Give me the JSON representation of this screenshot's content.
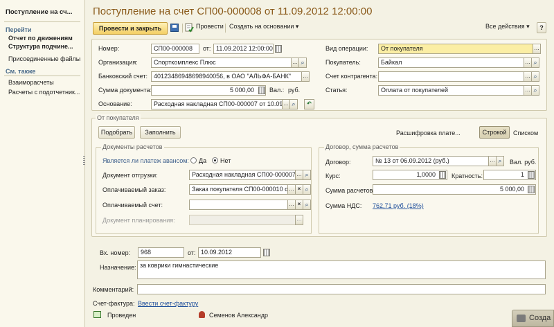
{
  "sidebar": {
    "header": "Поступление на сч...",
    "goto_title": "Перейти",
    "items": [
      {
        "label": "Отчет по движениям"
      },
      {
        "label": "Структура подчине..."
      },
      {
        "label": "Присоединенные файлы"
      }
    ],
    "see_also_title": "См. также",
    "see_also_items": [
      {
        "label": "Взаиморасчеты"
      },
      {
        "label": "Расчеты с подотчетник..."
      }
    ]
  },
  "title": "Поступление на счет СП00-000008 от 11.09.2012 12:00:00",
  "toolbar": {
    "post_close": "Провести и закрыть",
    "post": "Провести",
    "create_based": "Создать на основании",
    "all_actions": "Все действия",
    "help": "?"
  },
  "header": {
    "number_label": "Номер:",
    "number_value": "СП00-000008",
    "from_label": "от:",
    "date_value": "11.09.2012 12:00:00",
    "org_label": "Организация:",
    "org_value": "Спорткомплекс Плюс",
    "bank_label": "Банковский счет:",
    "bank_value": "40123486948698940056, в ОАО \"АЛЬФА-БАНК\"",
    "sum_label": "Сумма документа:",
    "sum_value": "5 000,00",
    "currency_label": "Вал.:",
    "currency_value": "руб.",
    "basis_label": "Основание:",
    "basis_value": "Расходная накладная СП00-000007 от 10.09.20",
    "op_type_label": "Вид операции:",
    "op_type_value": "От покупателя",
    "buyer_label": "Покупатель:",
    "buyer_value": "Байкал",
    "contractor_acc_label": "Счет контрагента:",
    "contractor_acc_value": "",
    "article_label": "Статья:",
    "article_value": "Оплата от покупателей"
  },
  "from_buyer": {
    "title": "От покупателя",
    "select_btn": "Подобрать",
    "fill_btn": "Заполнить",
    "breakdown_label": "Расшифровка плате...",
    "by_row_btn": "Строкой",
    "by_list_btn": "Списком",
    "docs": {
      "title": "Документы расчетов",
      "advance_label": "Является ли платеж авансом:",
      "yes": "Да",
      "no": "Нет",
      "shipment_label": "Документ отгрузки:",
      "shipment_value": "Расходная накладная СП00-000007 о",
      "order_label": "Оплачиваемый заказ:",
      "order_value": "Заказ покупателя СП00-000010 о",
      "invoice_label": "Оплачиваемый счет:",
      "invoice_value": "",
      "planning_label": "Документ планирования:",
      "planning_value": ""
    },
    "contract": {
      "title": "Договор, сумма расчетов",
      "contract_label": "Договор:",
      "contract_value": "№ 13 от 06.09.2012 (руб.)",
      "currency_label": "Вал. руб.",
      "rate_label": "Курс:",
      "rate_value": "1,0000",
      "multiplicity_label": "Кратность:",
      "multiplicity_value": "1",
      "sum_label": "Сумма расчетов:",
      "sum_value": "5 000,00",
      "vat_label": "Сумма НДС:",
      "vat_value": "762,71 руб. (18%)"
    }
  },
  "footer": {
    "in_number_label": "Вх. номер:",
    "in_number_value": "968",
    "from_label": "от:",
    "in_date_value": "10.09.2012",
    "purpose_label": "Назначение:",
    "purpose_value": "за коврики гимнастические",
    "comment_label": "Комментарий:",
    "comment_value": "",
    "invoice_label": "Счет-фактура:",
    "invoice_link": "Ввести счет-фактуру",
    "status": "Проведен",
    "author": "Семенов Александр"
  },
  "corner": {
    "label": "Созда"
  },
  "colors": {
    "title": "#8a5a1a",
    "primary_button": "#f3cf64",
    "highlight_field": "#fbeea4",
    "link": "#1f4f9b"
  }
}
